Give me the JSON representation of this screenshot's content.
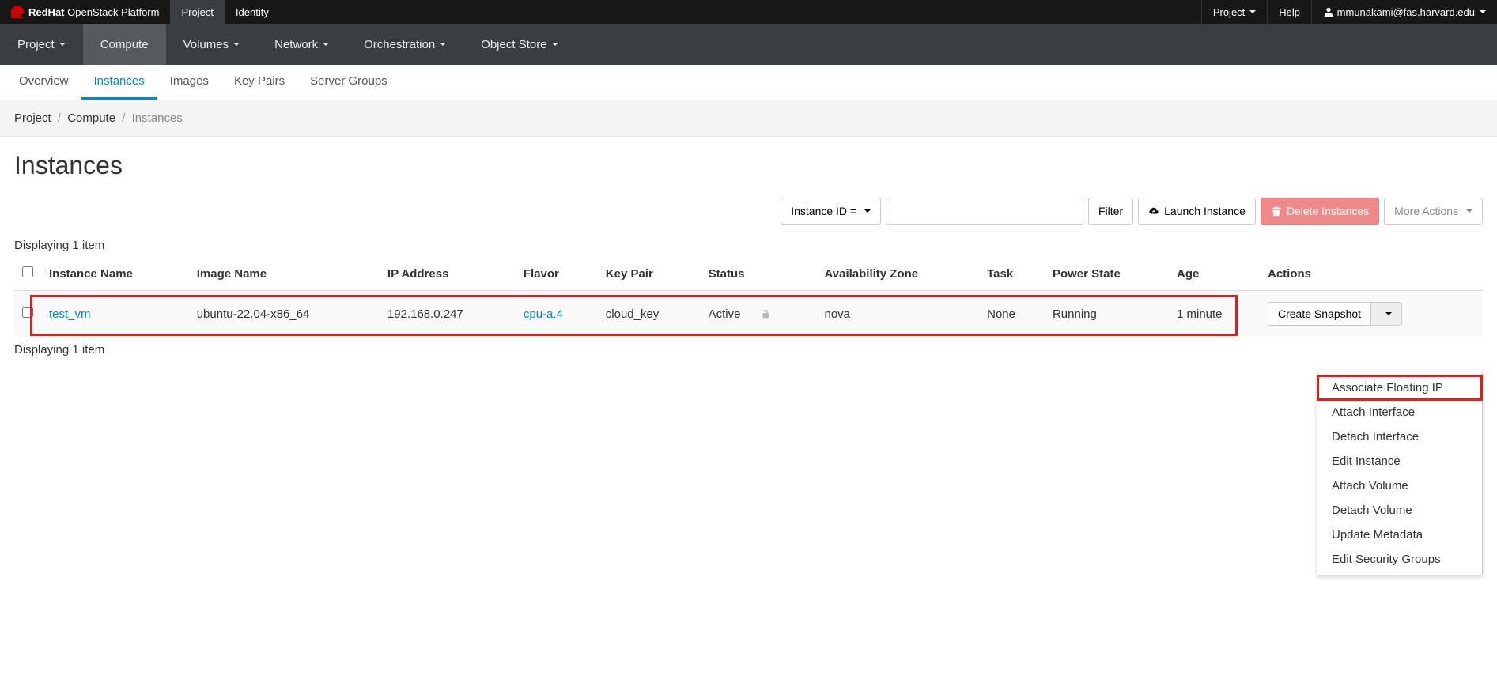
{
  "brand": {
    "bold": "RedHat",
    "light": "OpenStack Platform"
  },
  "topnav": {
    "tabs": [
      {
        "label": "Project",
        "active": true
      },
      {
        "label": "Identity",
        "active": false
      }
    ],
    "right": {
      "project_label": "Project",
      "help_label": "Help",
      "user_label": "mmunakami@fas.harvard.edu"
    }
  },
  "greynav": [
    {
      "label": "Project",
      "caret": true,
      "active": false
    },
    {
      "label": "Compute",
      "caret": false,
      "active": true
    },
    {
      "label": "Volumes",
      "caret": true,
      "active": false
    },
    {
      "label": "Network",
      "caret": true,
      "active": false
    },
    {
      "label": "Orchestration",
      "caret": true,
      "active": false
    },
    {
      "label": "Object Store",
      "caret": true,
      "active": false
    }
  ],
  "subnav": [
    {
      "label": "Overview",
      "active": false
    },
    {
      "label": "Instances",
      "active": true
    },
    {
      "label": "Images",
      "active": false
    },
    {
      "label": "Key Pairs",
      "active": false
    },
    {
      "label": "Server Groups",
      "active": false
    }
  ],
  "breadcrumb": {
    "items": [
      "Project",
      "Compute",
      "Instances"
    ]
  },
  "page_title": "Instances",
  "toolbar": {
    "filter_field": "Instance ID =",
    "filter_btn": "Filter",
    "launch_btn": "Launch Instance",
    "delete_btn": "Delete Instances",
    "more_btn": "More Actions"
  },
  "display_text": "Displaying 1 item",
  "columns": [
    "",
    "Instance Name",
    "Image Name",
    "IP Address",
    "Flavor",
    "Key Pair",
    "Status",
    "Availability Zone",
    "Task",
    "Power State",
    "Age",
    "Actions"
  ],
  "row": {
    "instance_name": "test_vm",
    "image_name": "ubuntu-22.04-x86_64",
    "ip_address": "192.168.0.247",
    "flavor": "cpu-a.4",
    "key_pair": "cloud_key",
    "status": "Active",
    "availability_zone": "nova",
    "task": "None",
    "power_state": "Running",
    "age": "1 minute",
    "action_primary": "Create Snapshot"
  },
  "dropdown": [
    "Associate Floating IP",
    "Attach Interface",
    "Detach Interface",
    "Edit Instance",
    "Attach Volume",
    "Detach Volume",
    "Update Metadata",
    "Edit Security Groups"
  ]
}
